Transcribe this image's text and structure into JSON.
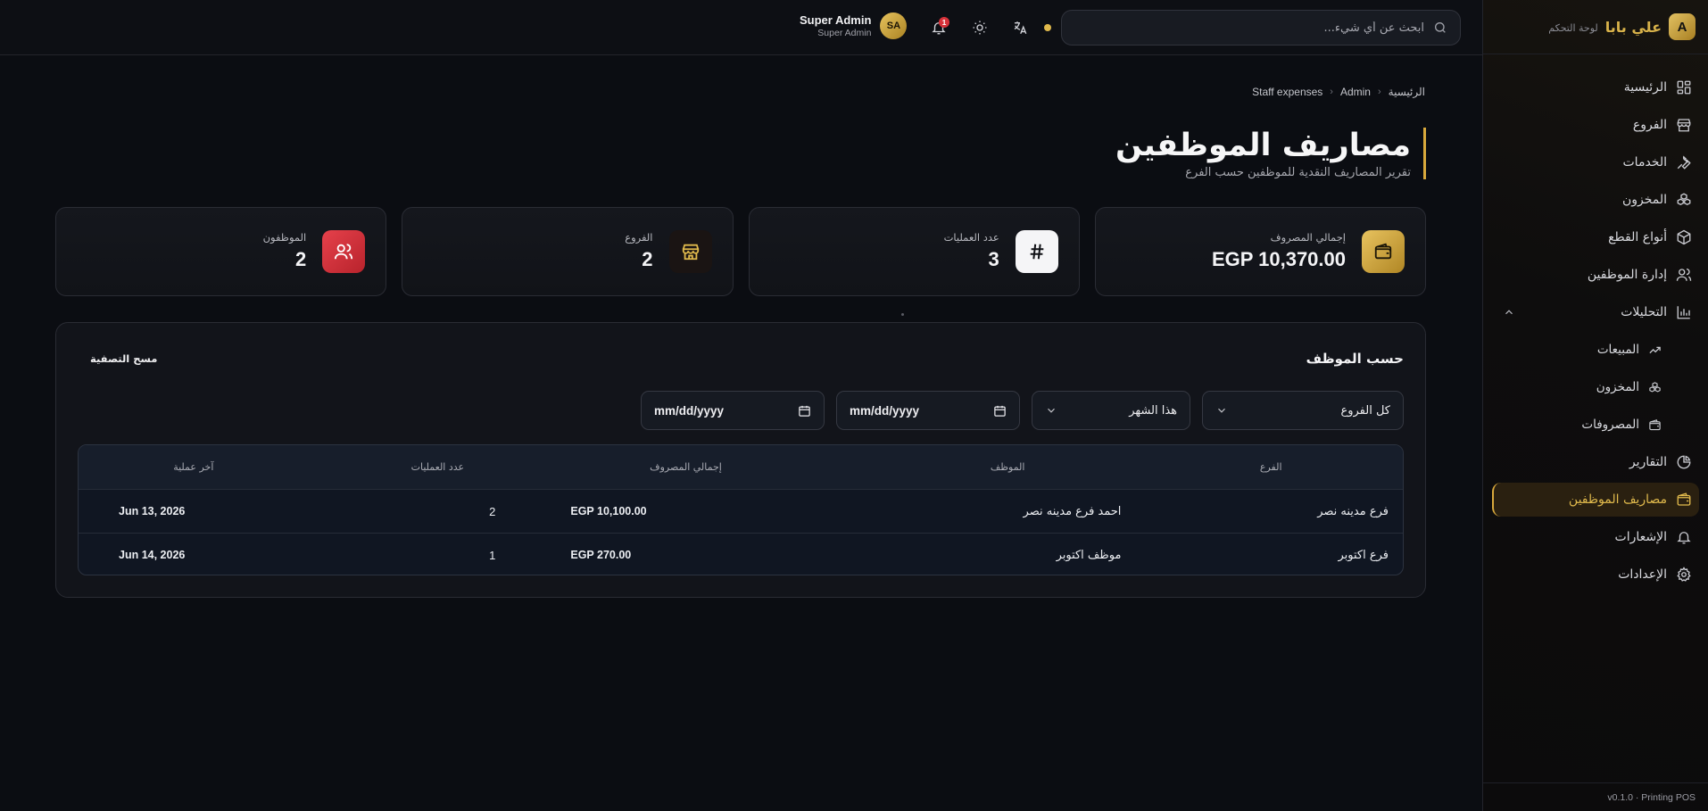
{
  "sidebar": {
    "logo_letter": "A",
    "brand": "علي بابا",
    "brand_sub": "لوحة التحكم",
    "items": [
      {
        "label": "الرئيسية",
        "icon": "dashboard-icon"
      },
      {
        "label": "الفروع",
        "icon": "store-icon"
      },
      {
        "label": "الخدمات",
        "icon": "wrench-icon"
      },
      {
        "label": "المخزون",
        "icon": "boxes-icon"
      },
      {
        "label": "أنواع القطع",
        "icon": "package-icon"
      },
      {
        "label": "إدارة الموظفين",
        "icon": "users-icon"
      },
      {
        "label": "التحليلات",
        "icon": "bar-chart-icon"
      },
      {
        "label": "المبيعات",
        "icon": "trending-up-icon"
      },
      {
        "label": "المخزون",
        "icon": "boxes-icon"
      },
      {
        "label": "المصروفات",
        "icon": "wallet-icon"
      },
      {
        "label": "التقارير",
        "icon": "pie-chart-icon"
      },
      {
        "label": "مصاريف الموظفين",
        "icon": "wallet-icon"
      },
      {
        "label": "الإشعارات",
        "icon": "bell-icon"
      },
      {
        "label": "الإعدادات",
        "icon": "gear-icon"
      }
    ],
    "footer": "v0.1.0 · Printing POS"
  },
  "topbar": {
    "search_placeholder": "ابحث عن أي شيء...",
    "notifications_count": "1",
    "user_name": "Super Admin",
    "user_role": "Super Admin",
    "avatar_initials": "SA",
    "accent": "#e0b94c"
  },
  "breadcrumb": [
    "الرئيسية",
    "Admin",
    "Staff expenses"
  ],
  "page": {
    "title": "مصاريف الموظفين",
    "subtitle": "تقرير المصاريف النقدية للموظفين حسب الفرع"
  },
  "cards": [
    {
      "label": "إجمالي المصروف",
      "value": "EGP 10,370.00",
      "icon": "wallet-icon"
    },
    {
      "label": "عدد العمليات",
      "value": "3",
      "icon": "hash-icon"
    },
    {
      "label": "الفروع",
      "value": "2",
      "icon": "store-icon"
    },
    {
      "label": "الموظفون",
      "value": "2",
      "icon": "users-icon"
    }
  ],
  "panel": {
    "title": "حسب الموظف",
    "reset_label": "مسح التصفية",
    "filters": {
      "branch": "كل الفروع",
      "period": "هذا الشهر",
      "date_from": "mm/dd/yyyy",
      "date_to": "mm/dd/yyyy"
    },
    "columns": [
      "الفرع",
      "الموظف",
      "إجمالي المصروف",
      "عدد العمليات",
      "آخر عملية"
    ],
    "rows": [
      {
        "branch": "فرع مدينه نصر",
        "employee": "احمد فرع مدينه نصر",
        "total": "EGP 10,100.00",
        "count": "2",
        "last": "Jun 13, 2026"
      },
      {
        "branch": "فرع اكتوبر",
        "employee": "موظف اكتوبر",
        "total": "EGP 270.00",
        "count": "1",
        "last": "Jun 14, 2026"
      }
    ]
  }
}
